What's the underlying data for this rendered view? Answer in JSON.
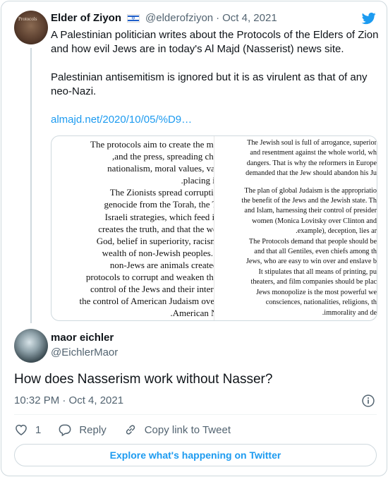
{
  "parent_tweet": {
    "author_name": "Elder of Ziyon",
    "flag": "israel-flag",
    "handle": "@elderofziyon",
    "separator": "·",
    "date": "Oct 4, 2021",
    "avatar_text": "Protocols",
    "paragraphs": [
      "A Palestinian politician writes about the Protocols of the Elders of Zion and how evil Jews are in today's Al Majd (Nasserist) news site.",
      "Palestinian antisemitism is ignored but it is as virulent as that of any neo-Nazi."
    ],
    "link": "almajd.net/2020/10/05/%D9…",
    "media": {
      "left_lines": [
        "The protocols aim to create the me",
        ",and the press, spreading cha",
        "nationalism, moral values, val",
        ".placing it",
        "The Zionists spread corruptic",
        "genocide from the Torah, the T",
        "Israeli strategies, which feed ir",
        "creates the truth, and that the wo",
        "God, belief in superiority, racism",
        "wealth of non-Jewish peoples. .",
        "non-Jews are animals created",
        "protocols to corrupt and weaken the",
        "control of the Jews and their intere",
        "the control of American Judaism over",
        ".American N"
      ],
      "right_lines_a": [
        "The Jewish soul is full of arrogance, superior",
        "and resentment against the whole world, wh",
        "dangers. That is why the reformers in Europe",
        "demanded that the Jew should abandon his Ju"
      ],
      "right_lines_b": [
        "The plan of global Judaism is the appropriatio",
        "the benefit of the Jews and the Jewish state. Th",
        "and Islam, harnessing their control of presider",
        "women (Monica Lovitsky over Clinton and",
        ".example), deception, lies ar",
        "The Protocols demand that people should be",
        "and that all Gentiles, even chiefs among th",
        "Jews, who are easy to win over and enslave b",
        "It stipulates that all means of printing, pu",
        "theaters, and film companies should be plac",
        "Jews monopolize is the most powerful we",
        "consciences, nationalities, religions, th",
        ".immorality and de"
      ]
    }
  },
  "reply_tweet": {
    "author_name": "maor eichler",
    "handle": "@EichlerMaor",
    "text": "How does Nasserism work without Nasser?",
    "timestamp": "10:32 PM · Oct 4, 2021"
  },
  "actions": {
    "like_count": "1",
    "reply_label": "Reply",
    "copy_link_label": "Copy link to Tweet"
  },
  "explore_label": "Explore what's happening on Twitter",
  "colors": {
    "accent": "#1d9bf0",
    "muted_text": "#536471",
    "border": "#cfd9de"
  }
}
